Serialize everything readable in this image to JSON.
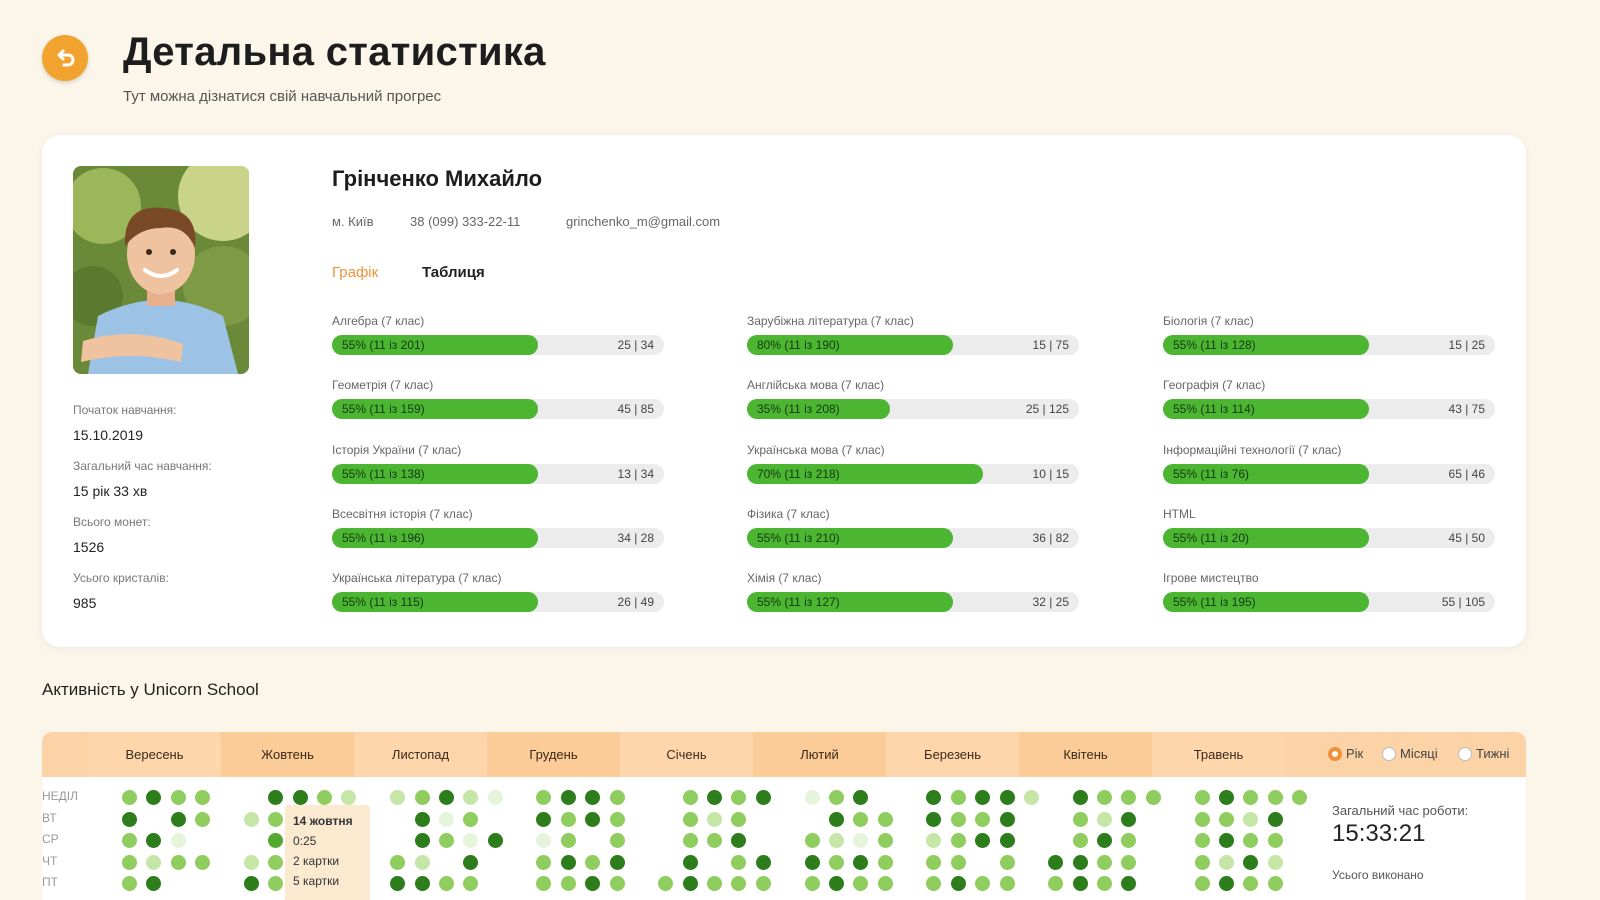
{
  "header": {
    "title": "Детальна статистика",
    "subtitle": "Тут можна дізнатися свій навчальний прогрес"
  },
  "student": {
    "name": "Грінченко Михайло",
    "city": "м. Київ",
    "phone": "38 (099) 333-22-11",
    "email": "grinchenko_m@gmail.com"
  },
  "stats": [
    {
      "label": "Початок навчання:",
      "value": "15.10.2019"
    },
    {
      "label": "Загальний час навчання:",
      "value": "15 рік 33 хв"
    },
    {
      "label": "Всього монет:",
      "value": "1526"
    },
    {
      "label": "Усього кристалів:",
      "value": "985"
    }
  ],
  "tabs": [
    {
      "label": "Графік",
      "active": true
    },
    {
      "label": "Таблиця",
      "active": false
    }
  ],
  "subjects": [
    {
      "name": "Алгебра (7 клас)",
      "progress_text": "55% (11 із 201)",
      "percent": 62,
      "count": "25 | 34"
    },
    {
      "name": "Геометрія (7 клас)",
      "progress_text": "55% (11 із 159)",
      "percent": 62,
      "count": "45 | 85"
    },
    {
      "name": "Історія України (7 клас)",
      "progress_text": "55% (11 із 138)",
      "percent": 62,
      "count": "13 | 34"
    },
    {
      "name": "Всесвітня історія (7 клас)",
      "progress_text": "55% (11 із 196)",
      "percent": 62,
      "count": "34 | 28"
    },
    {
      "name": "Українська література (7 клас)",
      "progress_text": "55% (11 із 115)",
      "percent": 62,
      "count": "26 | 49"
    },
    {
      "name": "Зарубіжна література (7 клас)",
      "progress_text": "80% (11 із 190)",
      "percent": 62,
      "count": "15 | 75"
    },
    {
      "name": "Англійська мова (7 клас)",
      "progress_text": "35% (11 із 208)",
      "percent": 43,
      "count": "25 | 125"
    },
    {
      "name": "Українська мова (7 клас)",
      "progress_text": "70% (11 із 218)",
      "percent": 71,
      "count": "10 | 15"
    },
    {
      "name": "Фізика (7 клас)",
      "progress_text": "55% (11 із 210)",
      "percent": 62,
      "count": "36 | 82"
    },
    {
      "name": "Хімія (7 клас)",
      "progress_text": "55% (11 із 127)",
      "percent": 62,
      "count": "32 | 25"
    },
    {
      "name": "Біологія (7 клас)",
      "progress_text": "55% (11 із 128)",
      "percent": 62,
      "count": "15 | 25"
    },
    {
      "name": "Географія (7 клас)",
      "progress_text": "55% (11 із 114)",
      "percent": 62,
      "count": "43 | 75"
    },
    {
      "name": "Інформаційні технології (7 клас)",
      "progress_text": "55% (11 із 76)",
      "percent": 62,
      "count": "65 | 46"
    },
    {
      "name": "HTML",
      "progress_text": "55% (11 із 20)",
      "percent": 62,
      "count": "45 | 50"
    },
    {
      "name": "Ігрове мистецтво",
      "progress_text": "55% (11 із 195)",
      "percent": 62,
      "count": "55 | 105"
    }
  ],
  "activity": {
    "title": "Активність у Unicorn School",
    "months": [
      "Вересень",
      "Жовтень",
      "Листопад",
      "Грудень",
      "Січень",
      "Лютий",
      "Березень",
      "Квітень",
      "Травень"
    ],
    "periods": [
      {
        "label": "Рік",
        "selected": true
      },
      {
        "label": "Місяці",
        "selected": false
      },
      {
        "label": "Тижні",
        "selected": false
      }
    ],
    "days": [
      "НЕДІЛ",
      "ВТ",
      "СР",
      "ЧТ",
      "ПТ"
    ],
    "level_colors": [
      "#ffffff",
      "#e5f4da",
      "#c5e6a7",
      "#8fcd5f",
      "#55a830",
      "#2e7d1c"
    ],
    "grid": [
      [
        3,
        5,
        3,
        3,
        0,
        0,
        5,
        5,
        3,
        2,
        0,
        2,
        3,
        5,
        2,
        1,
        0,
        3,
        5,
        5,
        3,
        0,
        0,
        3,
        5,
        3,
        5,
        0,
        1,
        3,
        5,
        0,
        0,
        5,
        3,
        5,
        5,
        2,
        0,
        5,
        3,
        3,
        3,
        0,
        3,
        5,
        3,
        3,
        3
      ],
      [
        5,
        0,
        5,
        3,
        0,
        2,
        3,
        0,
        3,
        1,
        0,
        0,
        5,
        1,
        3,
        0,
        0,
        5,
        3,
        5,
        3,
        0,
        0,
        3,
        2,
        3,
        0,
        0,
        0,
        5,
        3,
        3,
        0,
        5,
        3,
        3,
        5,
        0,
        0,
        3,
        2,
        5,
        0,
        0,
        3,
        3,
        2,
        5,
        0
      ],
      [
        3,
        5,
        1,
        0,
        0,
        0,
        4,
        0,
        1,
        3,
        0,
        0,
        5,
        3,
        1,
        5,
        0,
        1,
        3,
        0,
        3,
        0,
        0,
        3,
        3,
        5,
        0,
        0,
        3,
        2,
        1,
        3,
        0,
        2,
        3,
        5,
        5,
        0,
        0,
        3,
        5,
        3,
        0,
        0,
        3,
        5,
        3,
        3,
        0
      ],
      [
        3,
        2,
        3,
        3,
        0,
        2,
        3,
        0,
        0,
        3,
        0,
        3,
        2,
        0,
        5,
        0,
        0,
        3,
        5,
        3,
        5,
        0,
        0,
        5,
        0,
        3,
        5,
        0,
        5,
        3,
        5,
        3,
        0,
        3,
        3,
        0,
        3,
        0,
        5,
        5,
        3,
        3,
        0,
        0,
        3,
        2,
        5,
        2,
        0
      ],
      [
        3,
        5,
        0,
        0,
        0,
        5,
        3,
        3,
        0,
        3,
        0,
        5,
        5,
        3,
        3,
        0,
        0,
        3,
        3,
        5,
        3,
        0,
        3,
        5,
        3,
        3,
        3,
        0,
        3,
        5,
        3,
        3,
        0,
        3,
        5,
        3,
        3,
        0,
        3,
        5,
        3,
        5,
        0,
        0,
        3,
        5,
        3,
        3,
        0
      ]
    ],
    "tooltip": {
      "date": "14 жовтня",
      "time": "0:25",
      "cards": "2 картки",
      "extra": "5 картки"
    },
    "total_label": "Загальний час роботи:",
    "total_time": "15:33:21",
    "done_label": "Усього виконано"
  }
}
